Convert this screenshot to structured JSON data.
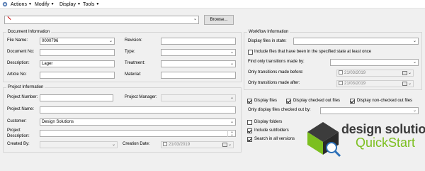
{
  "menu": {
    "items": [
      {
        "label": "Actions"
      },
      {
        "label": "Modify"
      },
      {
        "label": "Display"
      },
      {
        "label": "Tools"
      }
    ]
  },
  "top": {
    "path_value": "",
    "browse_label": "Browse..."
  },
  "document_info": {
    "title": "Document Information",
    "file_name_label": "File Name:",
    "file_name_value": "0000796",
    "document_no_label": "Document No:",
    "document_no_value": "",
    "description_label": "Description:",
    "description_value": "Lager",
    "article_no_label": "Article No:",
    "article_no_value": "",
    "revision_label": "Revision:",
    "revision_value": "",
    "type_label": "Type:",
    "type_value": "",
    "treatment_label": "Treatment:",
    "treatment_value": "",
    "material_label": "Material:",
    "material_value": ""
  },
  "project_info": {
    "title": "Project Information",
    "project_number_label": "Project Number:",
    "project_number_value": "",
    "project_manager_label": "Project Manager:",
    "project_manager_value": "",
    "project_name_label": "Project Name:",
    "project_name_value": "",
    "customer_label": "Customer:",
    "customer_value": "Design Solutions",
    "project_description_label": "Project Description:",
    "project_description_value": "",
    "created_by_label": "Created By:",
    "created_by_value": "",
    "creation_date_label": "Creation Date:",
    "creation_date_value": "21/03/2019"
  },
  "workflow_info": {
    "title": "Workflow Information",
    "display_files_in_state_label": "Display files in state:",
    "display_files_in_state_value": "",
    "include_files_label": "Include files that have been in the specified state at least once",
    "find_transitions_label": "Find only transitions made by:",
    "find_transitions_value": "",
    "transitions_before_label": "Only transitions made before:",
    "transitions_before_value": "21/03/2019",
    "transitions_after_label": "Only transitions made after:",
    "transitions_after_value": "21/03/2019"
  },
  "display_options": {
    "display_files_label": "Display files",
    "display_checked_out_label": "Display checked out files",
    "display_non_checked_out_label": "Display non-checked out files",
    "only_checked_out_by_label": "Only display files checked out by:",
    "only_checked_out_by_value": "",
    "display_folders_label": "Display folders",
    "include_subfolders_label": "Include subfolders",
    "search_all_versions_label": "Search in all versions"
  },
  "checkbox_states": {
    "include_files": false,
    "display_files": true,
    "display_checked_out": true,
    "display_non_checked_out": true,
    "display_folders": false,
    "include_subfolders": true,
    "search_all_versions": true
  },
  "logo": {
    "line1": "design solutions",
    "line2": "QuickStart"
  },
  "colors": {
    "logo_green": "#7cbf1f",
    "logo_dark": "#3b3b3b",
    "path_marker_red": "#cc0000"
  }
}
